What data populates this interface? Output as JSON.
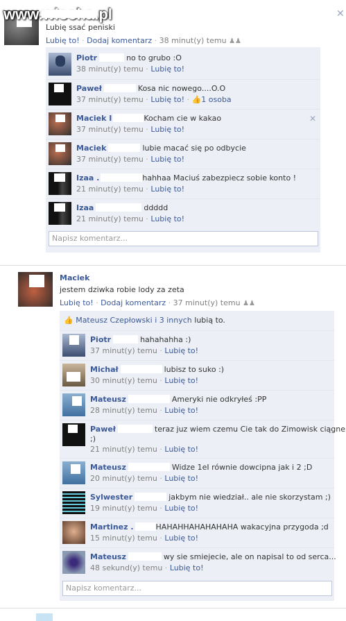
{
  "watermark": "www.wiocha.pl",
  "post1": {
    "text": "Lubię ssać peniski",
    "actions": {
      "like": "Lubię to!",
      "comment": "Dodaj komentarz",
      "time": "38 minut(y) temu"
    },
    "comments": [
      {
        "name": "Piotr",
        "text": "no to grubo :O",
        "time": "38 minut(y) temu",
        "like": "Lubię to!"
      },
      {
        "name": "Paweł",
        "text": "Kosa nic nowego....O.O",
        "time": "37 minut(y) temu",
        "like": "Lubię to!",
        "likes": "1 osoba"
      },
      {
        "name": "Maciek I",
        "text": "Kocham cie w kakao",
        "time": "37 minut(y) temu",
        "like": "Lubię to!"
      },
      {
        "name": "Maciek",
        "text": "lubie macać się po odbycie",
        "time": "37 minut(y) temu",
        "like": "Lubię to!"
      },
      {
        "name": "Izaa .",
        "text": "hahhaa Maciuś zabezpiecz sobie konto !",
        "time": "21 minut(y) temu",
        "like": "Lubię to!"
      },
      {
        "name": "Izaa",
        "text": "ddddd",
        "time": "21 minut(y) temu",
        "like": "Lubię to!"
      }
    ],
    "input_placeholder": "Napisz komentarz..."
  },
  "post2": {
    "name": "Maciek",
    "text": "jestem dziwka robie lody za zeta",
    "actions": {
      "like": "Lubię to!",
      "comment": "Dodaj komentarz",
      "time": "37 minut(y) temu"
    },
    "likes_bar": {
      "names": "Mateusz Czepłowski i 3 innych",
      "suffix": "lubią to."
    },
    "comments": [
      {
        "name": "Piotr",
        "text": "hahahahha :)",
        "time": "37 minut(y) temu",
        "like": "Lubię to!"
      },
      {
        "name": "Michał",
        "text": "lubisz to suko :)",
        "time": "30 minut(y) temu",
        "like": "Lubię to!"
      },
      {
        "name": "Mateusz",
        "text": "Ameryki nie odkryłeś :PP",
        "time": "28 minut(y) temu",
        "like": "Lubię to!"
      },
      {
        "name": "Paweł",
        "text": "teraz juz wiem czemu Cie tak do Zimowisk ciągnelo",
        "text2": ";)",
        "time": "21 minut(y) temu",
        "like": "Lubię to!"
      },
      {
        "name": "Mateusz",
        "text": "Widze 1eI równie dowcipna jak i 2 ;D",
        "time": "20 minut(y) temu",
        "like": "Lubię to!"
      },
      {
        "name": "Sylwester",
        "text": "jakbym nie wiedział.. ale nie skorzystam ;)",
        "time": "19 minut(y) temu",
        "like": "Lubię to!"
      },
      {
        "name": "Martinez .",
        "text": "HAHAHHAHAHAHAHA wakacyjna przygoda ;d",
        "time": "15 minut(y) temu",
        "like": "Lubię to!"
      },
      {
        "name": "Mateusz",
        "text": "wy sie smiejecie, ale on napisal to od serca...",
        "time": "48 sekund(y) temu",
        "like": "Lubię to!"
      }
    ],
    "input_placeholder": "Napisz komentarz..."
  },
  "colors": {
    "link": "#3b5998",
    "comment_bg": "#eceff5",
    "meta": "#808080"
  }
}
